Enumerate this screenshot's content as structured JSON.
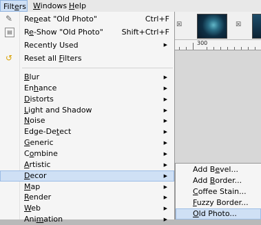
{
  "menubar": {
    "items": [
      {
        "label": "Filters",
        "mnemonic_index": 4
      },
      {
        "label": "Windows",
        "mnemonic_index": 0
      },
      {
        "label": "Help",
        "mnemonic_index": 0
      }
    ]
  },
  "filters_menu": {
    "repeat": {
      "pre": "Re",
      "mn": "p",
      "post": "eat \"Old Photo\"",
      "shortcut": "Ctrl+F"
    },
    "reshow": {
      "pre": "R",
      "mn": "e",
      "post": "-Show \"Old Photo\"",
      "shortcut": "Shift+Ctrl+F"
    },
    "recently_used": {
      "label": "Recently Used"
    },
    "reset": {
      "pre": "Reset all ",
      "mn": "F",
      "post": "ilters"
    },
    "categories": [
      {
        "pre": "",
        "mn": "B",
        "post": "lur"
      },
      {
        "pre": "En",
        "mn": "h",
        "post": "ance"
      },
      {
        "pre": "",
        "mn": "D",
        "post": "istorts"
      },
      {
        "pre": "",
        "mn": "L",
        "post": "ight and Shadow"
      },
      {
        "pre": "",
        "mn": "N",
        "post": "oise"
      },
      {
        "pre": "Edge-De",
        "mn": "t",
        "post": "ect"
      },
      {
        "pre": "",
        "mn": "G",
        "post": "eneric"
      },
      {
        "pre": "C",
        "mn": "o",
        "post": "mbine"
      },
      {
        "pre": "",
        "mn": "A",
        "post": "rtistic"
      },
      {
        "pre": "",
        "mn": "D",
        "post": "ecor"
      },
      {
        "pre": "",
        "mn": "M",
        "post": "ap"
      },
      {
        "pre": "",
        "mn": "R",
        "post": "ender"
      },
      {
        "pre": "",
        "mn": "W",
        "post": "eb"
      },
      {
        "pre": "Ani",
        "mn": "m",
        "post": "ation"
      }
    ],
    "highlighted": "Decor"
  },
  "decor_submenu": {
    "items": [
      {
        "pre": "Add B",
        "mn": "e",
        "post": "vel..."
      },
      {
        "pre": "Add ",
        "mn": "B",
        "post": "order..."
      },
      {
        "pre": "",
        "mn": "C",
        "post": "offee Stain..."
      },
      {
        "pre": "",
        "mn": "F",
        "post": "uzzy Border..."
      },
      {
        "pre": "",
        "mn": "O",
        "post": "ld Photo..."
      }
    ],
    "highlighted": "Old Photo..."
  },
  "background": {
    "ruler_mark": "300"
  },
  "icons": {
    "repeat": "repeat-filter-icon",
    "reshow": "reshow-filter-icon",
    "reset": "reset-filters-icon",
    "thumb_close": "close-icon",
    "submenu_arrow": "chevron-right-icon"
  },
  "colors": {
    "highlight": "#cfe0f5",
    "highlight_border": "#9cbde6",
    "menu_bg": "#f5f5f5"
  }
}
